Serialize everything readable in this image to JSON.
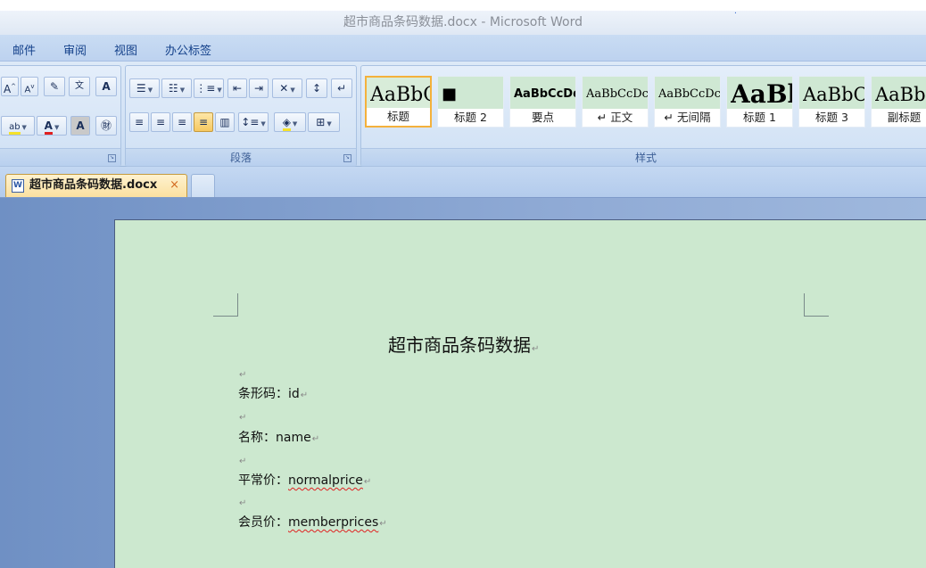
{
  "window": {
    "title": "超市商品条码数据.docx - Microsoft Word"
  },
  "menu": {
    "tabs": [
      "邮件",
      "审阅",
      "视图",
      "办公标签"
    ]
  },
  "ribbon": {
    "groups": {
      "paragraph": "段落",
      "styles": "样式"
    },
    "styles": [
      {
        "sample": "AaBbC",
        "name": "标题"
      },
      {
        "sample": "■",
        "name": "标题 2"
      },
      {
        "sample": "AaBbCcDd",
        "name": "要点"
      },
      {
        "sample": "AaBbCcDc",
        "name": "↵ 正文"
      },
      {
        "sample": "AaBbCcDc",
        "name": "↵ 无间隔"
      },
      {
        "sample": "AaBl",
        "name": "标题 1"
      },
      {
        "sample": "AaBbC",
        "name": "标题 3"
      },
      {
        "sample": "AaBb",
        "name": "副标题"
      }
    ]
  },
  "document_tabs": {
    "active": "超市商品条码数据.docx",
    "close": "×"
  },
  "document": {
    "title": "超市商品条码数据",
    "lines": [
      {
        "label": "条形码：",
        "value": "id"
      },
      {
        "label": "名称：",
        "value": "name"
      },
      {
        "label": "平常价：",
        "value": "normalprice"
      },
      {
        "label": "会员价：",
        "value": "memberprices"
      }
    ],
    "paragraph_mark": "↵"
  },
  "colors": {
    "page": "#cce8cf",
    "ribbon": "#d2e2f5",
    "tab_active": "#fbe0a0",
    "selected_style": "#f4b13c"
  }
}
